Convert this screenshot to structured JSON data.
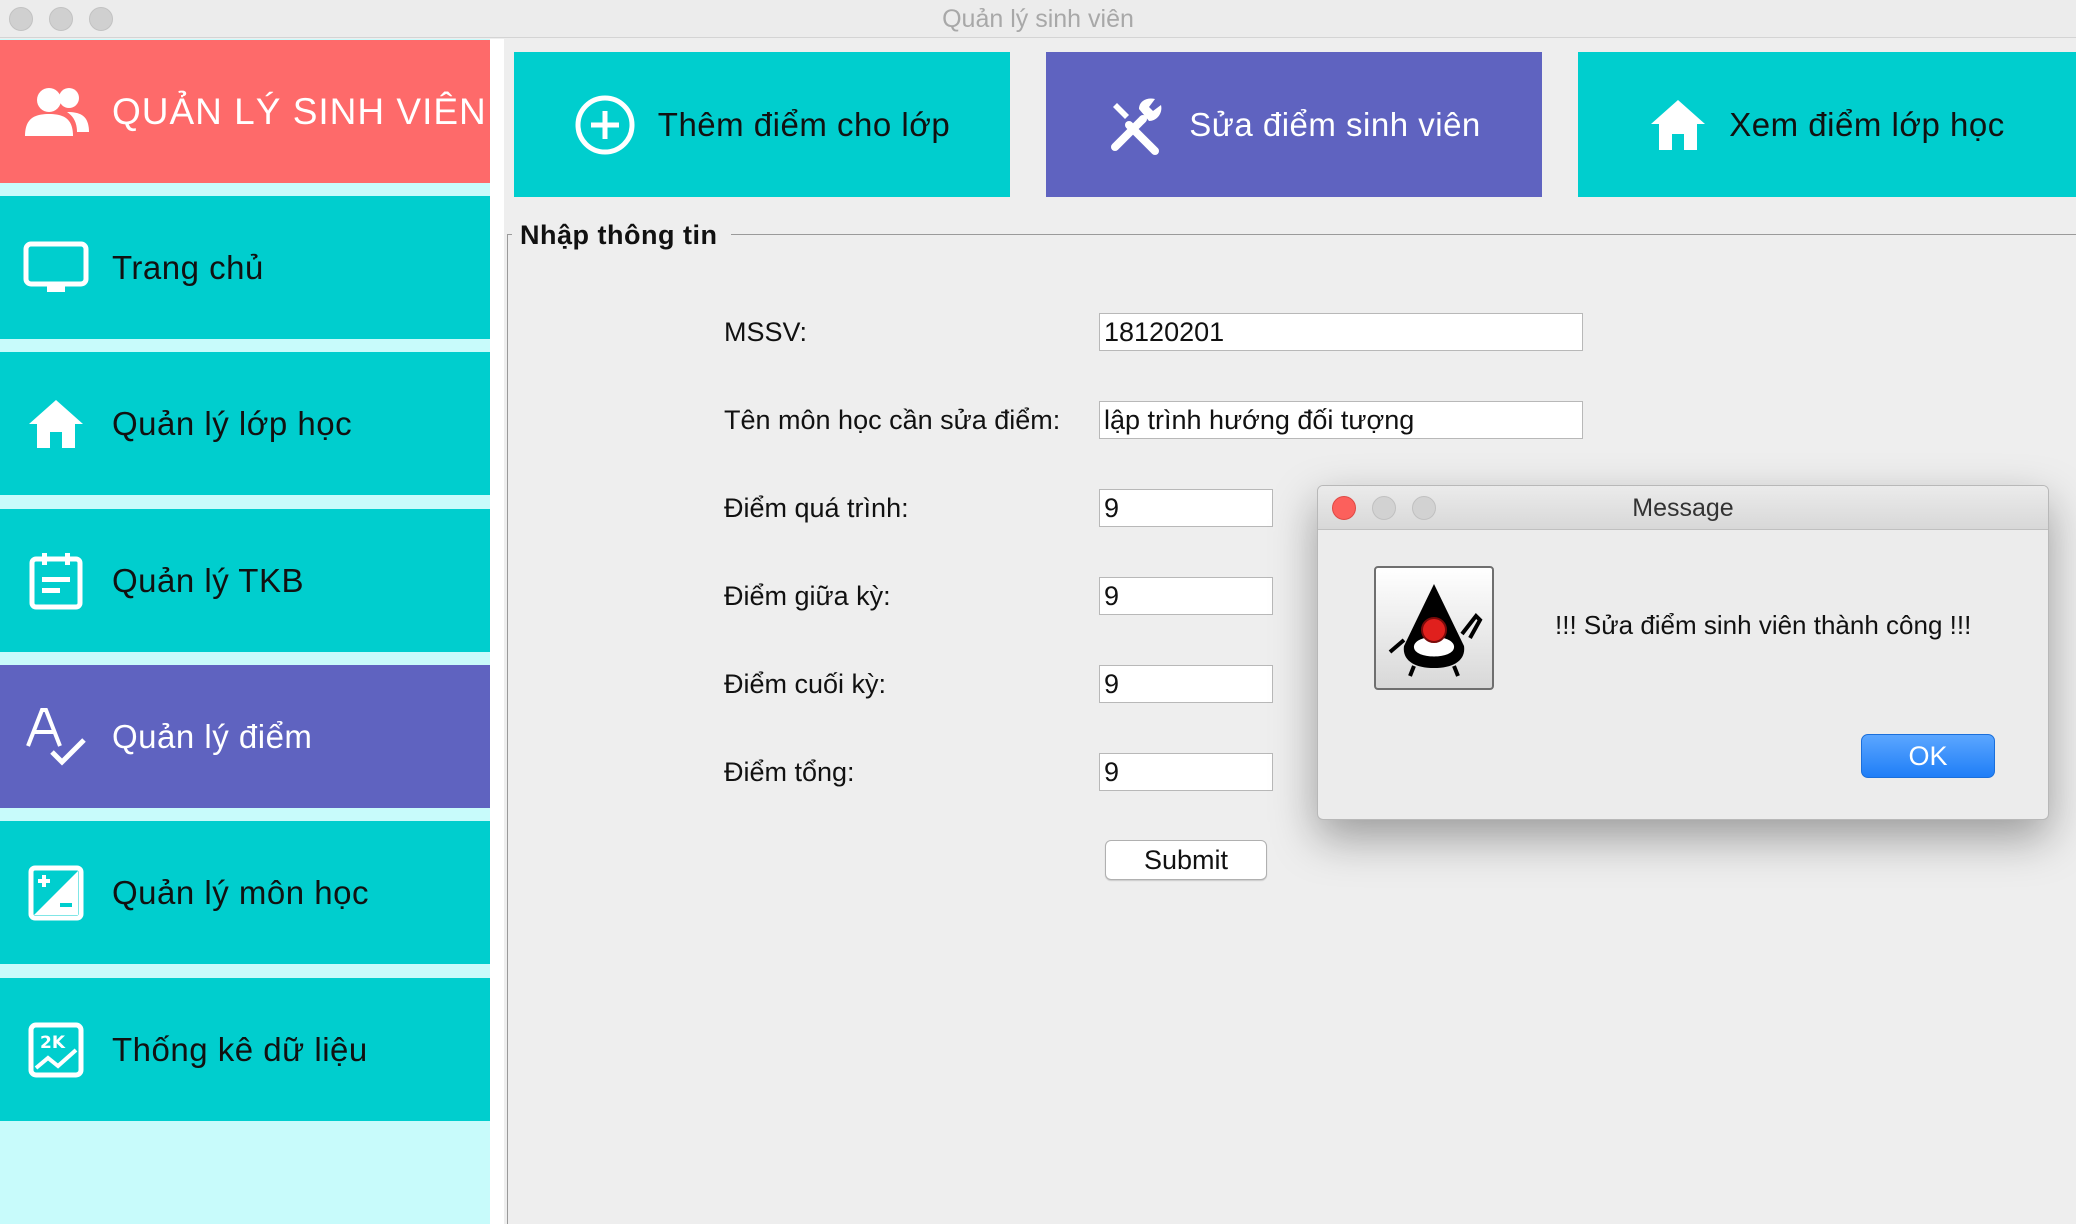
{
  "window": {
    "title": "Quản lý sinh viên"
  },
  "sidebar": {
    "header": {
      "label": "QUẢN LÝ SINH VIÊN",
      "icon": "users-icon"
    },
    "items": [
      {
        "label": "Trang chủ",
        "icon": "monitor-icon",
        "active": false
      },
      {
        "label": "Quản lý lớp học",
        "icon": "home-icon",
        "active": false
      },
      {
        "label": "Quản lý TKB",
        "icon": "calendar-icon",
        "active": false
      },
      {
        "label": "Quản lý điểm",
        "icon": "spellcheck-icon",
        "active": true
      },
      {
        "label": "Quản lý môn học",
        "icon": "plus-minus-icon",
        "active": false
      },
      {
        "label": "Thống kê dữ liệu",
        "icon": "chart-icon",
        "active": false
      }
    ]
  },
  "tabs": [
    {
      "label": "Thêm điểm cho lớp",
      "icon": "add-circle-icon",
      "active": false
    },
    {
      "label": "Sửa điểm sinh viên",
      "icon": "tools-icon",
      "active": true
    },
    {
      "label": "Xem điểm lớp học",
      "icon": "home-icon",
      "active": false
    }
  ],
  "form": {
    "legend": "Nhập thông tin",
    "fields": [
      {
        "label": "MSSV:",
        "value": "18120201"
      },
      {
        "label": "Tên môn học cần sửa điểm:",
        "value": "lập trình hướng đối tượng"
      },
      {
        "label": "Điểm quá trình:",
        "value": "9"
      },
      {
        "label": "Điểm giữa kỳ:",
        "value": "9"
      },
      {
        "label": "Điểm cuối kỳ:",
        "value": "9"
      },
      {
        "label": "Điểm tổng:",
        "value": "9"
      }
    ],
    "submit_label": "Submit"
  },
  "dialog": {
    "title": "Message",
    "message": "!!! Sửa điểm sinh viên thành công !!!",
    "ok_label": "OK",
    "icon": "java-duke-icon"
  },
  "colors": {
    "teal": "#00cece",
    "active_purple": "#5f63c0",
    "header_red": "#fe6a6a",
    "sidebar_bg": "#c8fbfb"
  }
}
